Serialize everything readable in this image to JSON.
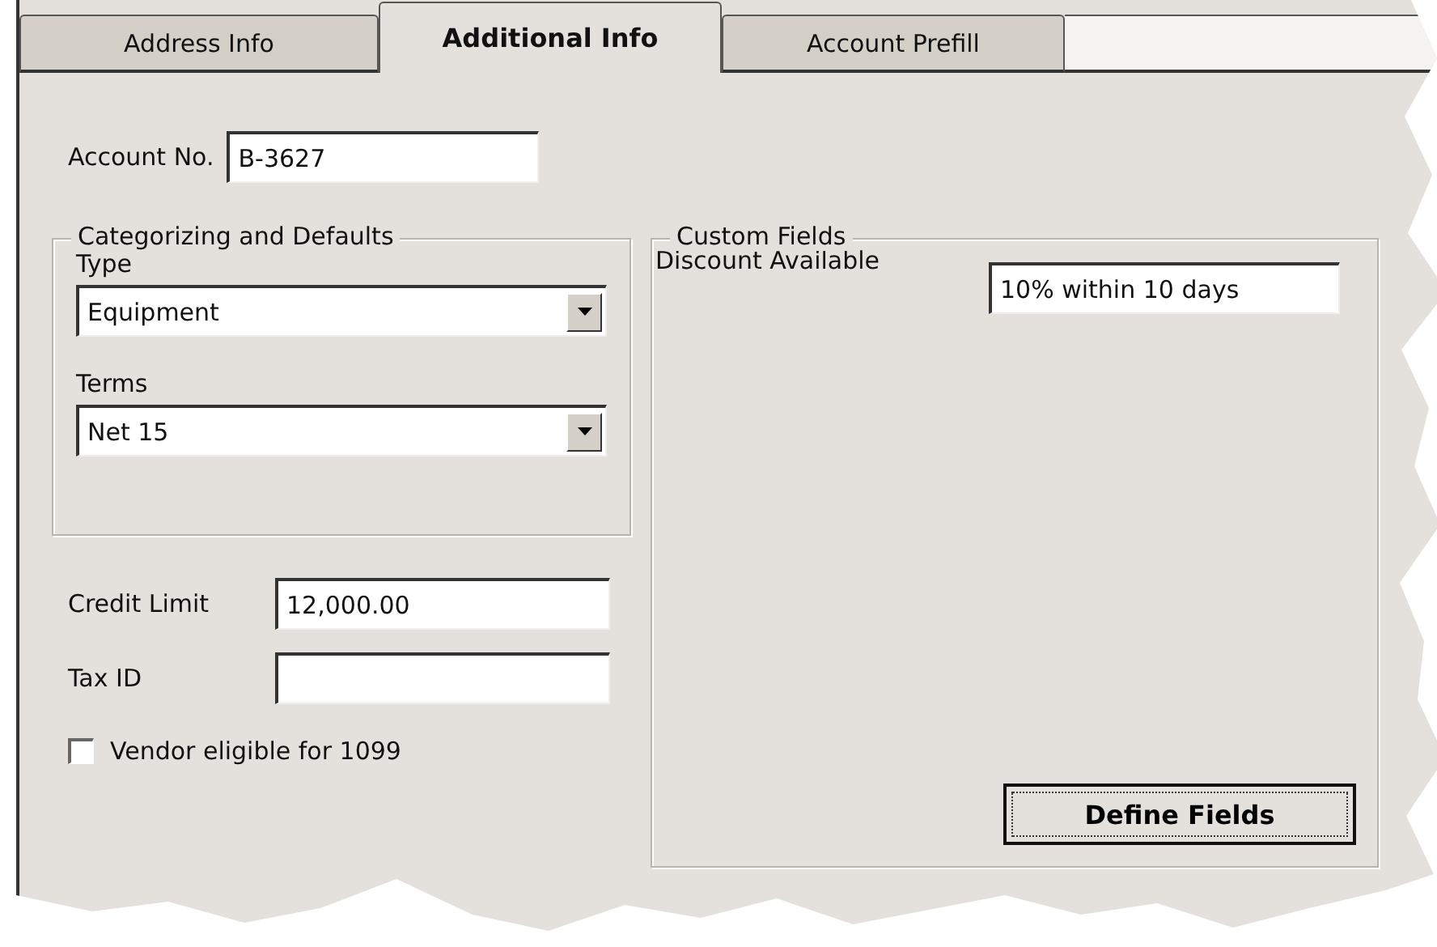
{
  "tabs": [
    {
      "label": "Address Info",
      "selected": false
    },
    {
      "label": "Additional Info",
      "selected": true
    },
    {
      "label": "Account Prefill",
      "selected": false
    }
  ],
  "account_no": {
    "label": "Account No.",
    "value": "B-3627"
  },
  "categorizing": {
    "title": "Categorizing and Defaults",
    "fields": [
      {
        "label": "Type",
        "value": "Equipment"
      },
      {
        "label": "Terms",
        "value": "Net 15"
      }
    ]
  },
  "credit_limit": {
    "label": "Credit Limit",
    "value": "12,000.00"
  },
  "tax_id": {
    "label": "Tax ID"
  },
  "vendor_1099": {
    "label": "Vendor eligible for 1099",
    "checked": false
  },
  "custom_fields": {
    "title": "Custom Fields",
    "fields": [
      {
        "label": "Discount Available",
        "value": "10% within 10 days"
      }
    ],
    "button": "Define Fields"
  }
}
